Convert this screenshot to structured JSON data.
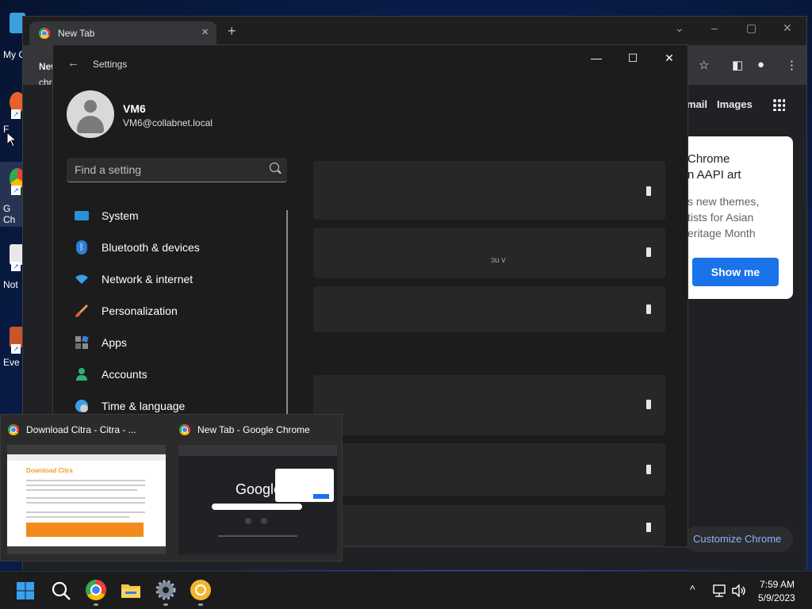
{
  "desktop": {
    "icons": [
      {
        "label": "My C"
      },
      {
        "label": "F"
      },
      {
        "label": "G"
      },
      {
        "label": "Ch"
      },
      {
        "label": "Not"
      },
      {
        "label": "Eve"
      }
    ]
  },
  "chrome": {
    "tab_title": "New Tab",
    "close_tab_icon": "×",
    "new_tab_icon": "+",
    "left_text_1": "New",
    "left_text_2": "chro",
    "links": {
      "gmail": "mail",
      "images": "Images"
    },
    "promo": {
      "line1": "Chrome",
      "line2": "n AAPI art",
      "body1": "s new themes,",
      "body2": "tists for Asian",
      "body3": "eritage Month",
      "button": "Show me"
    },
    "customize": "Customize Chrome"
  },
  "settings": {
    "title": "Settings",
    "user": {
      "name": "VM6",
      "email": "VM6@collabnet.local"
    },
    "search_placeholder": "Find a setting",
    "nav": [
      {
        "label": "System",
        "icon": "system-icon"
      },
      {
        "label": "Bluetooth & devices",
        "icon": "bluetooth-icon"
      },
      {
        "label": "Network & internet",
        "icon": "wifi-icon"
      },
      {
        "label": "Personalization",
        "icon": "brush-icon"
      },
      {
        "label": "Apps",
        "icon": "apps-icon"
      },
      {
        "label": "Accounts",
        "icon": "person-icon"
      },
      {
        "label": "Time & language",
        "icon": "globe-clock-icon"
      }
    ],
    "panel_fragment": "ɔu v"
  },
  "thumbnails": [
    {
      "title": "Download Citra - Citra - ..."
    },
    {
      "title": "New Tab - Google Chrome"
    }
  ],
  "thumb_preview": {
    "citra_heading": "Download Citra",
    "google_logo": "Google"
  },
  "taskbar": {
    "time": "7:59 AM",
    "date": "5/9/2023",
    "chevron": "^"
  },
  "colors": {
    "accent_blue": "#1a73e8",
    "link_blue": "#8ab4f8",
    "settings_bg": "#1c1c1c"
  }
}
